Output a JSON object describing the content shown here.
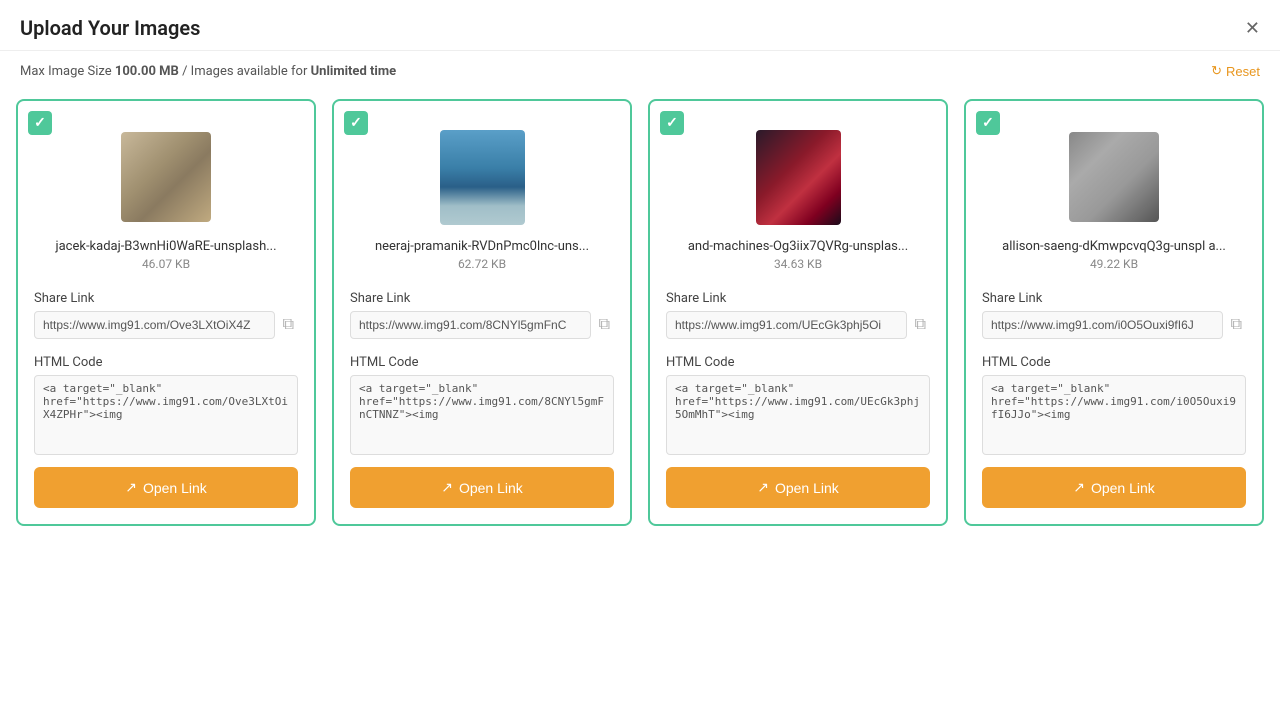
{
  "header": {
    "title": "Upload Your Images",
    "close_label": "×"
  },
  "info_bar": {
    "text_prefix": "Max Image Size ",
    "max_size": "100.00 MB",
    "text_mid": " / Images available for ",
    "availability": "Unlimited time",
    "reset_label": "Reset"
  },
  "cards": [
    {
      "id": 1,
      "check": "✓",
      "img_class": "img-1",
      "filename": "jacek-kadaj-B3wnHi0WaRE-unsplash...",
      "filesize": "46.07 KB",
      "share_link_label": "Share Link",
      "share_link": "https://www.img91.com/Ove3LXtOiX4Z",
      "html_code_label": "HTML Code",
      "html_code": "<a target=\"_blank\" href=\"https://www.img91.com/Ove3LXtOiX4ZPHr\"><img",
      "open_link_label": "Open Link"
    },
    {
      "id": 2,
      "check": "✓",
      "img_class": "img-2",
      "filename": "neeraj-pramanik-RVDnPmc0lnc-uns...",
      "filesize": "62.72 KB",
      "share_link_label": "Share Link",
      "share_link": "https://www.img91.com/8CNYl5gmFnC",
      "html_code_label": "HTML Code",
      "html_code": "<a target=\"_blank\" href=\"https://www.img91.com/8CNYl5gmFnCTNNZ\"><img",
      "open_link_label": "Open Link"
    },
    {
      "id": 3,
      "check": "✓",
      "img_class": "img-3",
      "filename": "and-machines-Og3iix7QVRg-unsplas...",
      "filesize": "34.63 KB",
      "share_link_label": "Share Link",
      "share_link": "https://www.img91.com/UEcGk3phj5Oi",
      "html_code_label": "HTML Code",
      "html_code": "<a target=\"_blank\" href=\"https://www.img91.com/UEcGk3phj5OmMhT\"><img",
      "open_link_label": "Open Link"
    },
    {
      "id": 4,
      "check": "✓",
      "img_class": "img-4",
      "filename": "allison-saeng-dKmwpcvqQ3g-unspl a...",
      "filesize": "49.22 KB",
      "share_link_label": "Share Link",
      "share_link": "https://www.img91.com/i0O5Ouxi9fI6J",
      "html_code_label": "HTML Code",
      "html_code": "<a target=\"_blank\" href=\"https://www.img91.com/i0O5Ouxi9fI6JJo\"><img",
      "open_link_label": "Open Link"
    }
  ],
  "icons": {
    "check": "✓",
    "close": "✕",
    "copy": "⧉",
    "open_link": "↗",
    "reset": "↻"
  }
}
